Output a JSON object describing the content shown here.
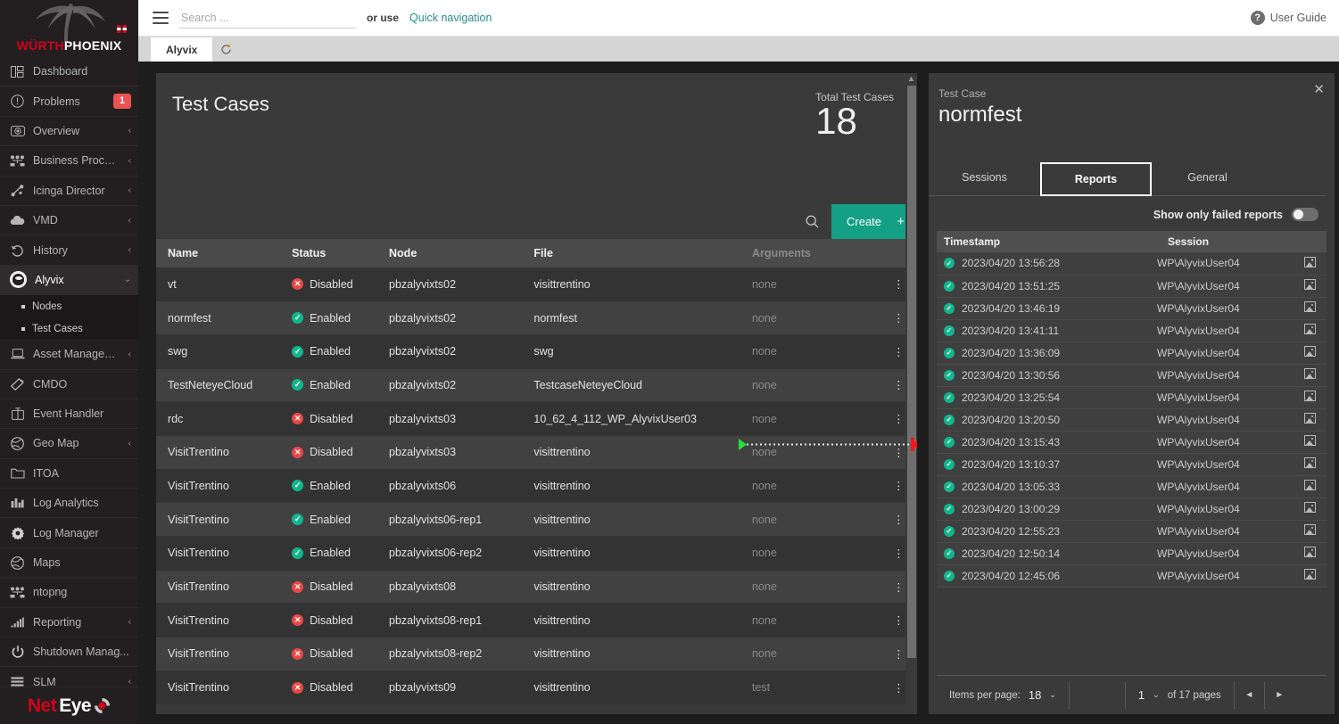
{
  "brand": {
    "wurth": "WÜRTH",
    "phoenix": "PHOENIX",
    "neteye_net": "Net",
    "neteye_eye": "Eye"
  },
  "topbar": {
    "search_placeholder": "Search ...",
    "search_value": "",
    "or_use": "or use",
    "quick_nav": "Quick navigation",
    "user_guide": "User Guide",
    "help_glyph": "?"
  },
  "tabbar": {
    "tab_label": "Alyvix"
  },
  "sidebar": {
    "items": [
      {
        "label": "Dashboard",
        "icon": "dashboard-icon",
        "chevron": false,
        "badge": null
      },
      {
        "label": "Problems",
        "icon": "problems-icon",
        "chevron": false,
        "badge": "1"
      },
      {
        "label": "Overview",
        "icon": "overview-icon",
        "chevron": true,
        "badge": null
      },
      {
        "label": "Business Process...",
        "icon": "business-process-icon",
        "chevron": true,
        "badge": null
      },
      {
        "label": "Icinga Director",
        "icon": "icinga-director-icon",
        "chevron": true,
        "badge": null
      },
      {
        "label": "VMD",
        "icon": "cloud-icon",
        "chevron": true,
        "badge": null
      },
      {
        "label": "History",
        "icon": "history-icon",
        "chevron": true,
        "badge": null
      },
      {
        "label": "Alyvix",
        "icon": "alyvix-icon",
        "chevron": true,
        "badge": null,
        "active": true
      },
      {
        "label": "Asset Management",
        "icon": "asset-management-icon",
        "chevron": true,
        "badge": null
      },
      {
        "label": "CMDO",
        "icon": "cmdo-icon",
        "chevron": false,
        "badge": null
      },
      {
        "label": "Event Handler",
        "icon": "event-handler-icon",
        "chevron": false,
        "badge": null
      },
      {
        "label": "Geo Map",
        "icon": "geo-map-icon",
        "chevron": true,
        "badge": null
      },
      {
        "label": "ITOA",
        "icon": "itoa-icon",
        "chevron": false,
        "badge": null
      },
      {
        "label": "Log Analytics",
        "icon": "log-analytics-icon",
        "chevron": false,
        "badge": null
      },
      {
        "label": "Log Manager",
        "icon": "log-manager-icon",
        "chevron": false,
        "badge": null
      },
      {
        "label": "Maps",
        "icon": "maps-icon",
        "chevron": false,
        "badge": null
      },
      {
        "label": "ntopng",
        "icon": "ntopng-icon",
        "chevron": false,
        "badge": null
      },
      {
        "label": "Reporting",
        "icon": "reporting-icon",
        "chevron": true,
        "badge": null
      },
      {
        "label": "Shutdown Manag...",
        "icon": "power-icon",
        "chevron": false,
        "badge": null
      },
      {
        "label": "SLM",
        "icon": "slm-icon",
        "chevron": true,
        "badge": null
      }
    ],
    "subitems": [
      {
        "label": "Nodes"
      },
      {
        "label": "Test Cases"
      }
    ]
  },
  "main": {
    "title": "Test Cases",
    "total_label": "Total Test Cases",
    "total_value": "18",
    "create_label": "Create",
    "create_plus": "+",
    "columns": [
      "Name",
      "Status",
      "Node",
      "File",
      "Arguments"
    ],
    "rows": [
      {
        "name": "vt",
        "status": "Disabled",
        "node": "pbzalyvixts02",
        "file": "visittrentino",
        "args": "none"
      },
      {
        "name": "normfest",
        "status": "Enabled",
        "node": "pbzalyvixts02",
        "file": "normfest",
        "args": "none"
      },
      {
        "name": "swg",
        "status": "Enabled",
        "node": "pbzalyvixts02",
        "file": "swg",
        "args": "none"
      },
      {
        "name": "TestNeteyeCloud",
        "status": "Enabled",
        "node": "pbzalyvixts02",
        "file": "TestcaseNeteyeCloud",
        "args": "none"
      },
      {
        "name": "rdc",
        "status": "Disabled",
        "node": "pbzalyvixts03",
        "file": "10_62_4_112_WP_AlyvixUser03",
        "args": "none"
      },
      {
        "name": "VisitTrentino",
        "status": "Disabled",
        "node": "pbzalyvixts03",
        "file": "visittrentino",
        "args": "none"
      },
      {
        "name": "VisitTrentino",
        "status": "Enabled",
        "node": "pbzalyvixts06",
        "file": "visittrentino",
        "args": "none"
      },
      {
        "name": "VisitTrentino",
        "status": "Enabled",
        "node": "pbzalyvixts06-rep1",
        "file": "visittrentino",
        "args": "none"
      },
      {
        "name": "VisitTrentino",
        "status": "Enabled",
        "node": "pbzalyvixts06-rep2",
        "file": "visittrentino",
        "args": "none"
      },
      {
        "name": "VisitTrentino",
        "status": "Disabled",
        "node": "pbzalyvixts08",
        "file": "visittrentino",
        "args": "none"
      },
      {
        "name": "VisitTrentino",
        "status": "Disabled",
        "node": "pbzalyvixts08-rep1",
        "file": "visittrentino",
        "args": "none"
      },
      {
        "name": "VisitTrentino",
        "status": "Disabled",
        "node": "pbzalyvixts08-rep2",
        "file": "visittrentino",
        "args": "none"
      },
      {
        "name": "VisitTrentino",
        "status": "Disabled",
        "node": "pbzalyvixts09",
        "file": "visittrentino",
        "args": "test"
      }
    ],
    "row_menu_glyph": "⋮"
  },
  "detail": {
    "label": "Test Case",
    "name": "normfest",
    "close_glyph": "✕",
    "tabs": [
      {
        "label": "Sessions",
        "selected": false
      },
      {
        "label": "Reports",
        "selected": true
      },
      {
        "label": "General",
        "selected": false
      }
    ],
    "toggle_label": "Show only failed reports",
    "toggle_on": false,
    "columns": [
      "Timestamp",
      "Session"
    ],
    "rows": [
      {
        "timestamp": "2023/04/20 13:56:28",
        "session": "WP\\AlyvixUser04",
        "status": "ok"
      },
      {
        "timestamp": "2023/04/20 13:51:25",
        "session": "WP\\AlyvixUser04",
        "status": "ok"
      },
      {
        "timestamp": "2023/04/20 13:46:19",
        "session": "WP\\AlyvixUser04",
        "status": "ok"
      },
      {
        "timestamp": "2023/04/20 13:41:11",
        "session": "WP\\AlyvixUser04",
        "status": "ok"
      },
      {
        "timestamp": "2023/04/20 13:36:09",
        "session": "WP\\AlyvixUser04",
        "status": "ok"
      },
      {
        "timestamp": "2023/04/20 13:30:56",
        "session": "WP\\AlyvixUser04",
        "status": "ok"
      },
      {
        "timestamp": "2023/04/20 13:25:54",
        "session": "WP\\AlyvixUser04",
        "status": "ok"
      },
      {
        "timestamp": "2023/04/20 13:20:50",
        "session": "WP\\AlyvixUser04",
        "status": "ok"
      },
      {
        "timestamp": "2023/04/20 13:15:43",
        "session": "WP\\AlyvixUser04",
        "status": "ok"
      },
      {
        "timestamp": "2023/04/20 13:10:37",
        "session": "WP\\AlyvixUser04",
        "status": "ok"
      },
      {
        "timestamp": "2023/04/20 13:05:33",
        "session": "WP\\AlyvixUser04",
        "status": "ok"
      },
      {
        "timestamp": "2023/04/20 13:00:29",
        "session": "WP\\AlyvixUser04",
        "status": "ok"
      },
      {
        "timestamp": "2023/04/20 12:55:23",
        "session": "WP\\AlyvixUser04",
        "status": "ok"
      },
      {
        "timestamp": "2023/04/20 12:50:14",
        "session": "WP\\AlyvixUser04",
        "status": "ok"
      },
      {
        "timestamp": "2023/04/20 12:45:06",
        "session": "WP\\AlyvixUser04",
        "status": "ok"
      }
    ],
    "pager": {
      "items_per_page_label": "Items per page:",
      "items_per_page_value": "18",
      "page_value": "1",
      "of_pages": "of 17 pages",
      "prev_glyph": "◄",
      "next_glyph": "►",
      "caret": "⌄"
    }
  },
  "annotation": {
    "type": "drag-arrow",
    "start_color": "#25e03a",
    "line_color": "#e8e8e8",
    "end_color": "#ff1313"
  },
  "colors": {
    "accent_teal": "#13a085",
    "brand_red": "#d0021b",
    "status_enabled": "#12b58c",
    "status_disabled": "#e84848",
    "badge_red": "#ec5353",
    "link_teal": "#2b8c8c"
  }
}
